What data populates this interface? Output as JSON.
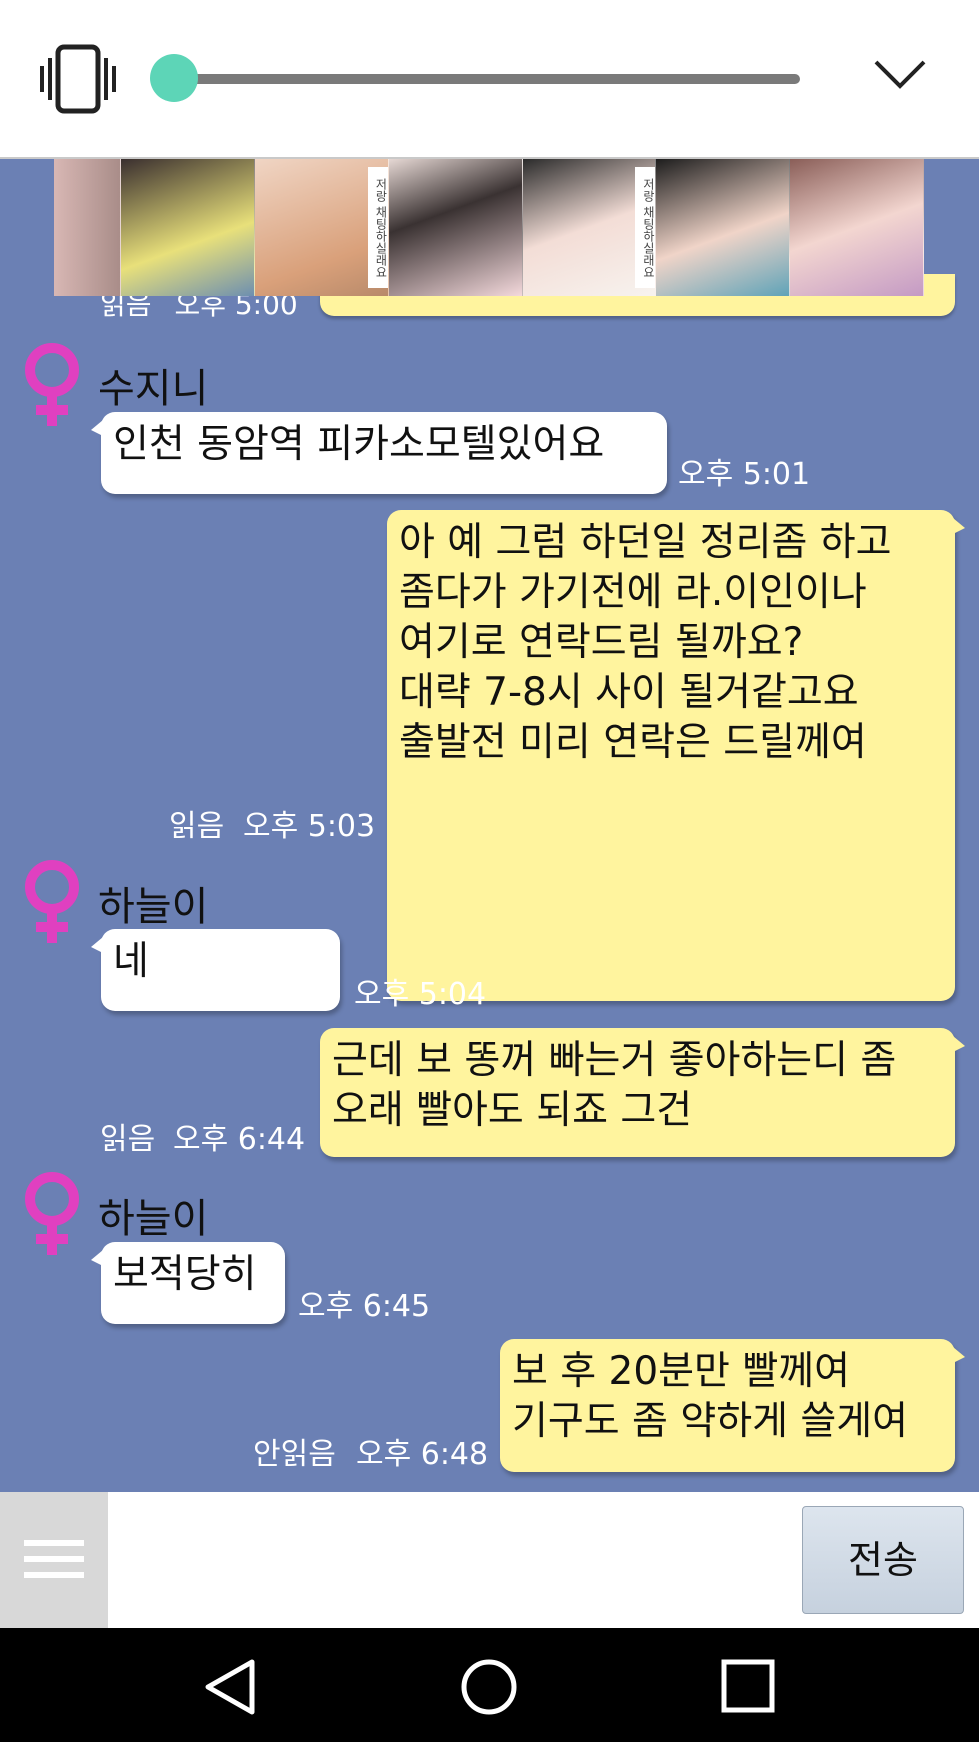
{
  "colors": {
    "chat_background": "#6b80b4",
    "outgoing_bubble": "#fff49e",
    "incoming_bubble": "#ffffff",
    "slider_knob": "#5dd5b7",
    "female_icon": "#e040c0"
  },
  "top_bar": {
    "vibrate_icon": "vibrate-icon",
    "slider_value": 0.0,
    "collapse_icon": "chevron-down-icon"
  },
  "banner": {
    "vertical_texts": [
      "저랑 채팅하실래요",
      "저랑 채팅하실래요"
    ]
  },
  "previous_message": {
    "status": "읽음",
    "time": "오후 5:00"
  },
  "messages": [
    {
      "side": "in",
      "sender": "수지니",
      "text": "인천 동암역 피카소모텔있어요",
      "time": "오후 5:01"
    },
    {
      "side": "out",
      "text": "아 예 그럼 하던일 정리좀 하고\n좀다가 가기전에 라.이인이나\n여기로 연락드림 될까요?\n대략 7-8시 사이 될거같고요\n출발전 미리 연락은 드릴께여",
      "status": "읽음",
      "time": "오후 5:03"
    },
    {
      "side": "in",
      "sender": "하늘이",
      "text": "네",
      "time": "오후 5:04"
    },
    {
      "side": "out",
      "text": "근데 보 똥꺼 빠는거 좋아하는디 좀\n오래 빨아도 되죠 그건",
      "status": "읽음",
      "time": "오후 6:44"
    },
    {
      "side": "in",
      "sender": "하늘이",
      "text": "보적당히",
      "time": "오후 6:45"
    },
    {
      "side": "out",
      "text": "보 후 20분만 빨께여\n기구도 좀 약하게 쓸게여",
      "status": "안읽음",
      "time": "오후 6:48"
    }
  ],
  "input": {
    "value": "",
    "send_label": "전송",
    "menu_icon": "menu-icon"
  },
  "nav": {
    "back_icon": "back-triangle-icon",
    "home_icon": "home-circle-icon",
    "recents_icon": "recents-square-icon"
  }
}
